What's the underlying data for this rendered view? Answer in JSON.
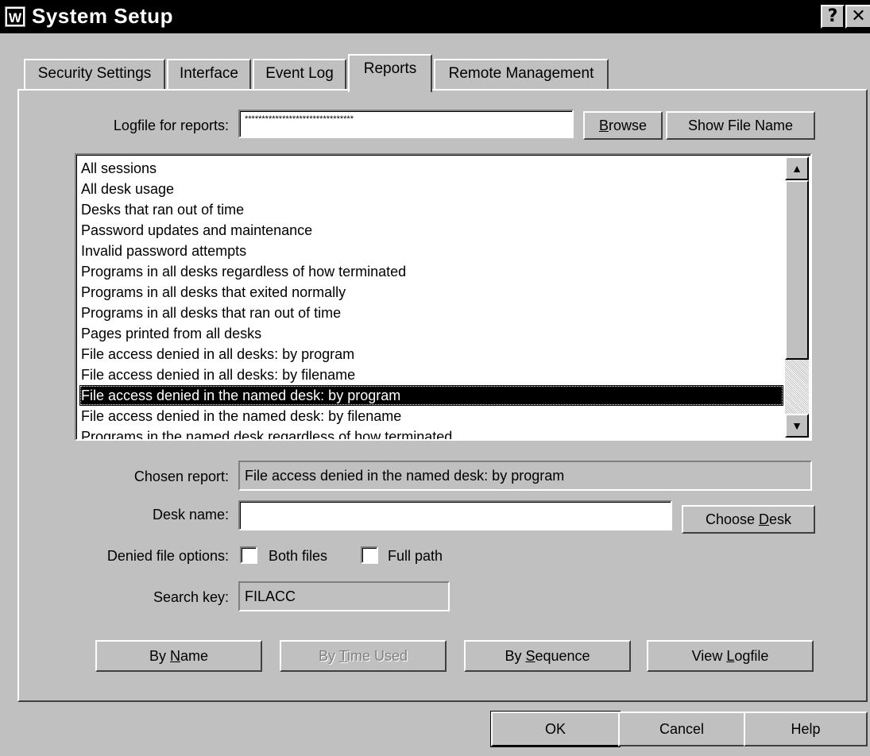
{
  "window": {
    "title": "System Setup",
    "icon_letter": "W",
    "help_glyph": "?",
    "close_glyph": "✕"
  },
  "tabs": [
    {
      "label": "Security Settings",
      "active": false
    },
    {
      "label": "Interface",
      "active": false
    },
    {
      "label": "Event Log",
      "active": false
    },
    {
      "label": "Reports",
      "active": true
    },
    {
      "label": "Remote Management",
      "active": false
    }
  ],
  "logfile": {
    "label": "Logfile for reports:",
    "value": "********************************",
    "browse_prefix": "",
    "browse_mnemonic": "B",
    "browse_rest": "rowse",
    "show_file_name_label": "Show File Name"
  },
  "reports": {
    "items": [
      "All sessions",
      "All desk usage",
      "Desks that ran out of time",
      "Password updates and maintenance",
      "Invalid password attempts",
      "Programs in all desks regardless of how terminated",
      "Programs in all desks that exited normally",
      "Programs in all desks that ran out of time",
      "Pages printed from all desks",
      "File access denied in all desks: by program",
      "File access denied in all desks: by filename",
      "File access denied in the named desk: by program",
      "File access denied in the named desk: by filename",
      "Programs in the named desk regardless of how terminated"
    ],
    "selected_index": 11,
    "scroll_up_glyph": "▲",
    "scroll_down_glyph": "▼"
  },
  "chosen_report": {
    "label": "Chosen report:",
    "value": "File access denied in the named desk: by program"
  },
  "desk_name": {
    "label": "Desk name:",
    "value": "",
    "choose_prefix": "Choose ",
    "choose_mnemonic": "D",
    "choose_rest": "esk"
  },
  "denied_options": {
    "label": "Denied file options:",
    "both_files_label": "Both files",
    "both_files_checked": false,
    "full_path_label": "Full path",
    "full_path_checked": false
  },
  "search_key": {
    "label": "Search key:",
    "value": "FILACC"
  },
  "actions": {
    "by_name_prefix": "By ",
    "by_name_mnemonic": "N",
    "by_name_rest": "ame",
    "by_time_prefix": "By ",
    "by_time_mnemonic": "T",
    "by_time_rest": "ime Used",
    "by_sequence_prefix": "By ",
    "by_sequence_mnemonic": "S",
    "by_sequence_rest": "equence",
    "view_logfile_prefix": "View ",
    "view_logfile_mnemonic": "L",
    "view_logfile_rest": "ogfile"
  },
  "dialog_buttons": {
    "ok": "OK",
    "cancel": "Cancel",
    "help": "Help"
  }
}
